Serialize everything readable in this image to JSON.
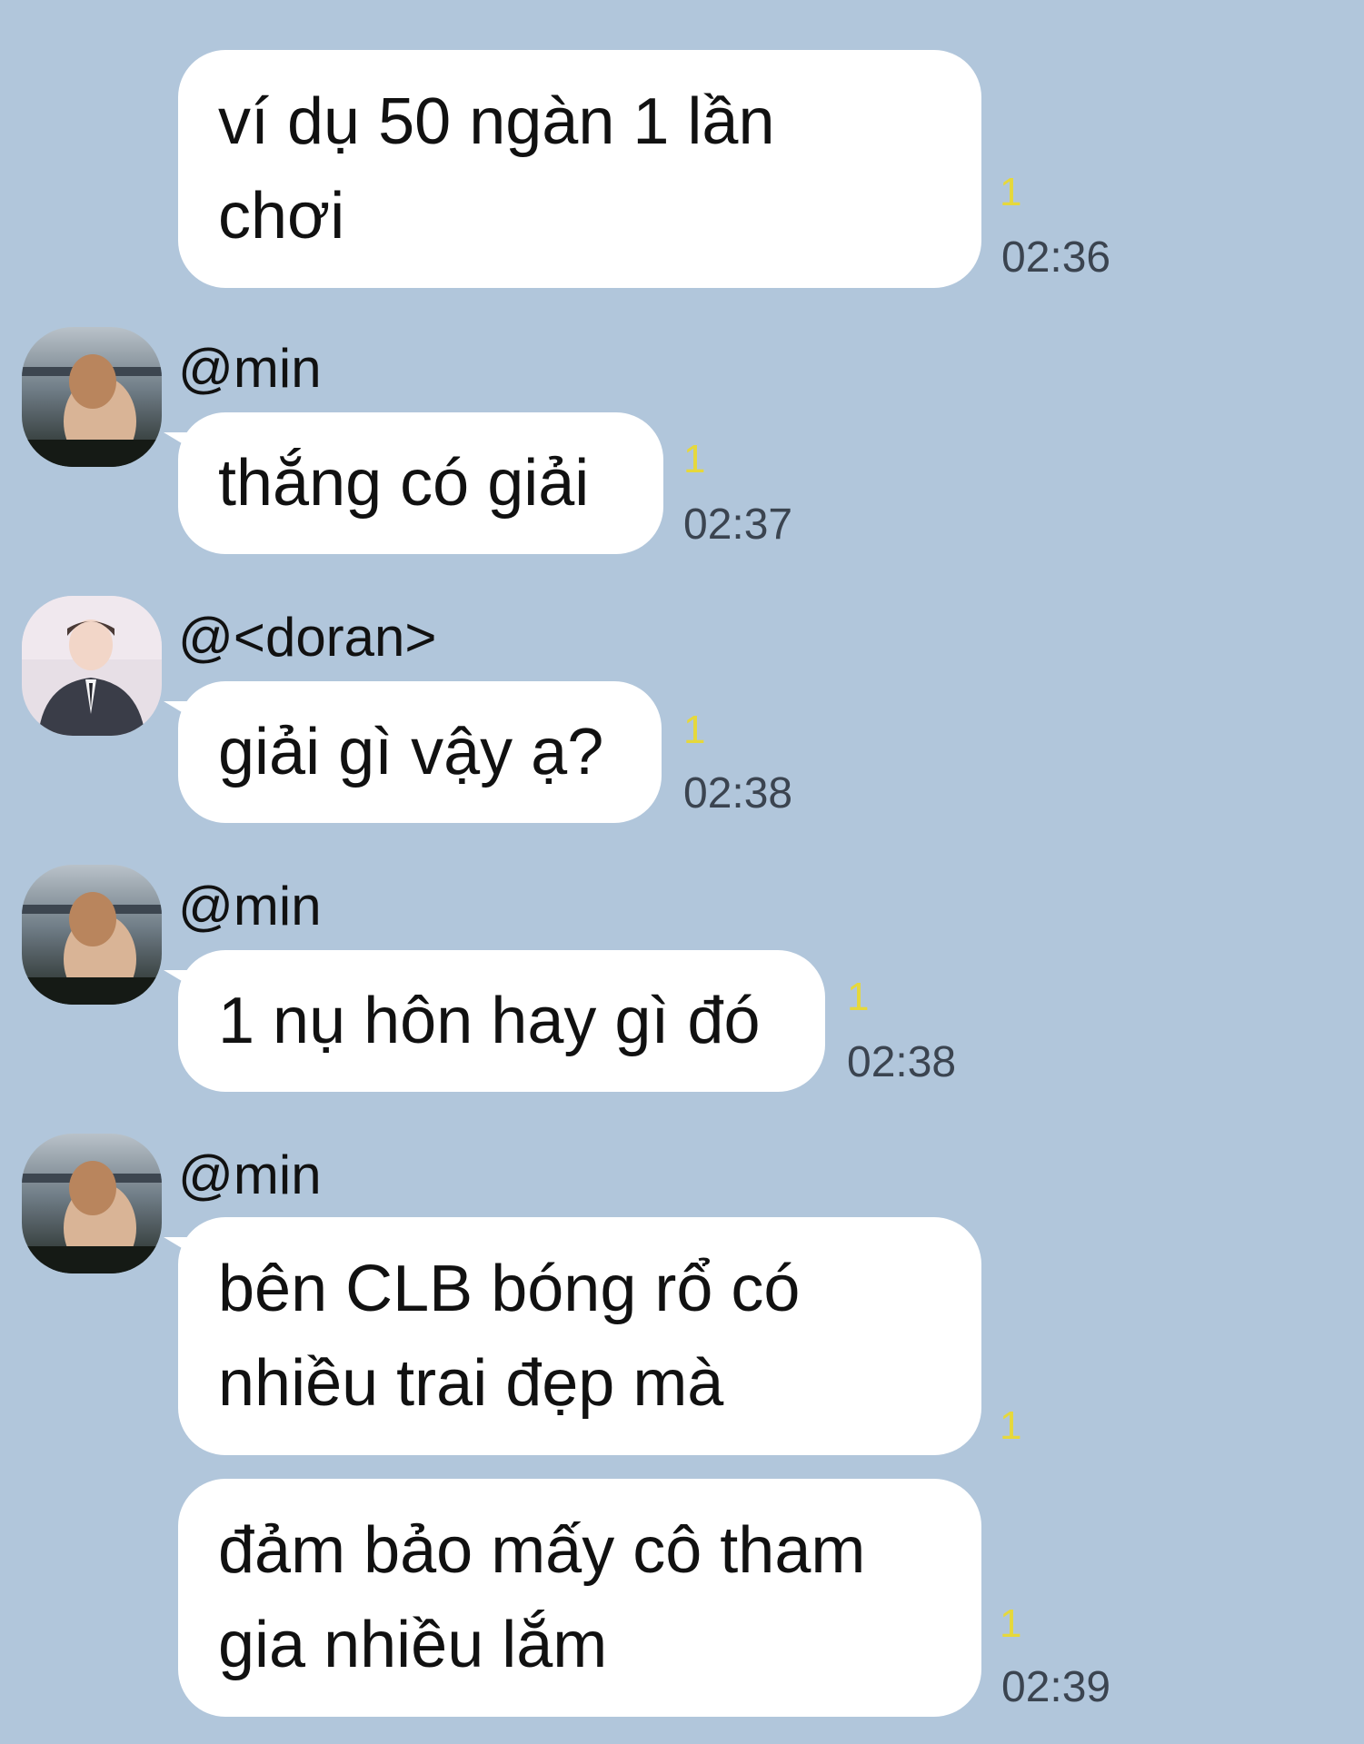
{
  "messages": [
    {
      "text": "ví dụ 50 ngàn 1 lần\nchơi",
      "unread": "1",
      "time": "02:36"
    },
    {
      "sender": "@min",
      "text": "thắng có giải",
      "unread": "1",
      "time": "02:37"
    },
    {
      "sender": "@<doran>",
      "text": "giải gì vậy ạ?",
      "unread": "1",
      "time": "02:38"
    },
    {
      "sender": "@min",
      "text": "1 nụ hôn hay gì đó",
      "unread": "1",
      "time": "02:38"
    },
    {
      "sender": "@min",
      "text": "bên CLB bóng rổ có\nnhiều trai đẹp mà",
      "unread": "1"
    },
    {
      "text": "đảm bảo mấy cô tham\ngia nhiều lắm",
      "unread": "1",
      "time": "02:39"
    }
  ],
  "colors": {
    "background": "#b1c6db",
    "bubble": "#ffffff",
    "unread": "#e6d83b",
    "time": "#3b4450"
  }
}
